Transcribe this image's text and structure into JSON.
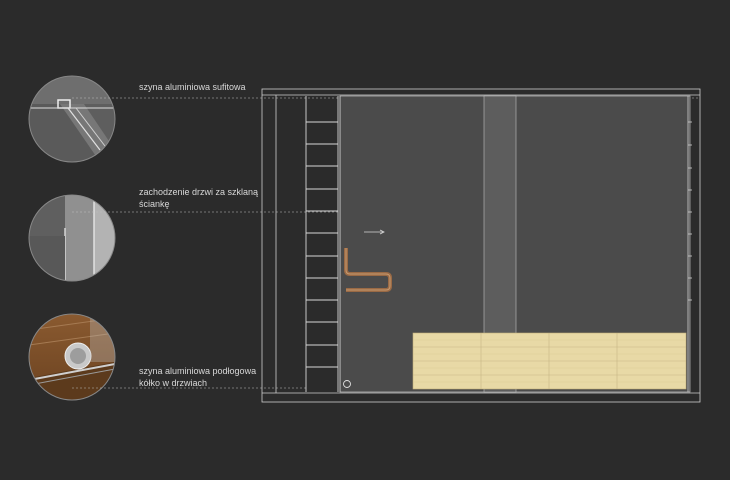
{
  "callouts": [
    {
      "line1": "szyna aluminiowa sufitowa",
      "line2": ""
    },
    {
      "line1": "zachodzenie drzwi za szklaną",
      "line2": "ściankę"
    },
    {
      "line1": "szyna aluminiowa podłogowa",
      "line2": "kółko w drzwiach"
    }
  ],
  "colors": {
    "background": "#2b2b2b",
    "line": "#cfcfcf",
    "glass": "#4a4a4a",
    "wood": "#e8d9a6",
    "handle": "#9a6a45"
  }
}
